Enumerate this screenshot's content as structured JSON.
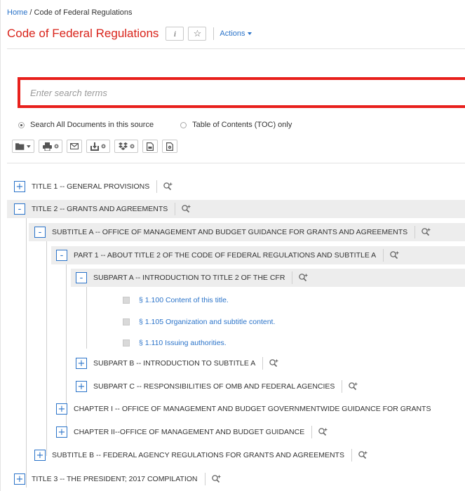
{
  "breadcrumb": {
    "home": "Home",
    "separator": " / ",
    "current": "Code of Federal Regulations"
  },
  "header": {
    "title": "Code of Federal Regulations",
    "info_label": "i",
    "star_label": "☆",
    "actions_label": "Actions"
  },
  "search": {
    "placeholder": "Enter search terms",
    "value": ""
  },
  "scope": {
    "all_label": "Search All Documents in this source",
    "toc_label": "Table of Contents (TOC) only",
    "selected": "all"
  },
  "toolbar": {
    "icons": [
      "folder-icon",
      "print-icon",
      "email-icon",
      "download-icon",
      "dropbox-icon",
      "document-icon",
      "document-settings-icon"
    ]
  },
  "tree": {
    "title1": "TITLE 1 -- GENERAL PROVISIONS",
    "title2": "TITLE 2 -- GRANTS AND AGREEMENTS",
    "subtitle_a": "SUBTITLE A -- OFFICE OF MANAGEMENT AND BUDGET GUIDANCE FOR GRANTS AND AGREEMENTS",
    "part1": "PART 1 -- ABOUT TITLE 2 OF THE CODE OF FEDERAL REGULATIONS AND SUBTITLE A",
    "subpart_a": "SUBPART A -- INTRODUCTION TO TITLE 2 OF THE CFR",
    "sec_1100": "§ 1.100 Content of this title.",
    "sec_1105": "§ 1.105 Organization and subtitle content.",
    "sec_1110": "§ 1.110 Issuing authorities.",
    "subpart_b": "SUBPART B -- INTRODUCTION TO SUBTITLE A",
    "subpart_c": "SUBPART C -- RESPONSIBILITIES OF OMB AND FEDERAL AGENCIES",
    "chapter_i": "CHAPTER I -- OFFICE OF MANAGEMENT AND BUDGET GOVERNMENTWIDE GUIDANCE FOR GRANTS",
    "chapter_ii": "CHAPTER II--OFFICE OF MANAGEMENT AND BUDGET GUIDANCE",
    "subtitle_b": "SUBTITLE B -- FEDERAL AGENCY REGULATIONS FOR GRANTS AND AGREEMENTS",
    "title3": "TITLE 3 -- THE PRESIDENT; 2017 COMPILATION",
    "expand_symbol": "+",
    "collapse_symbol": "-"
  }
}
